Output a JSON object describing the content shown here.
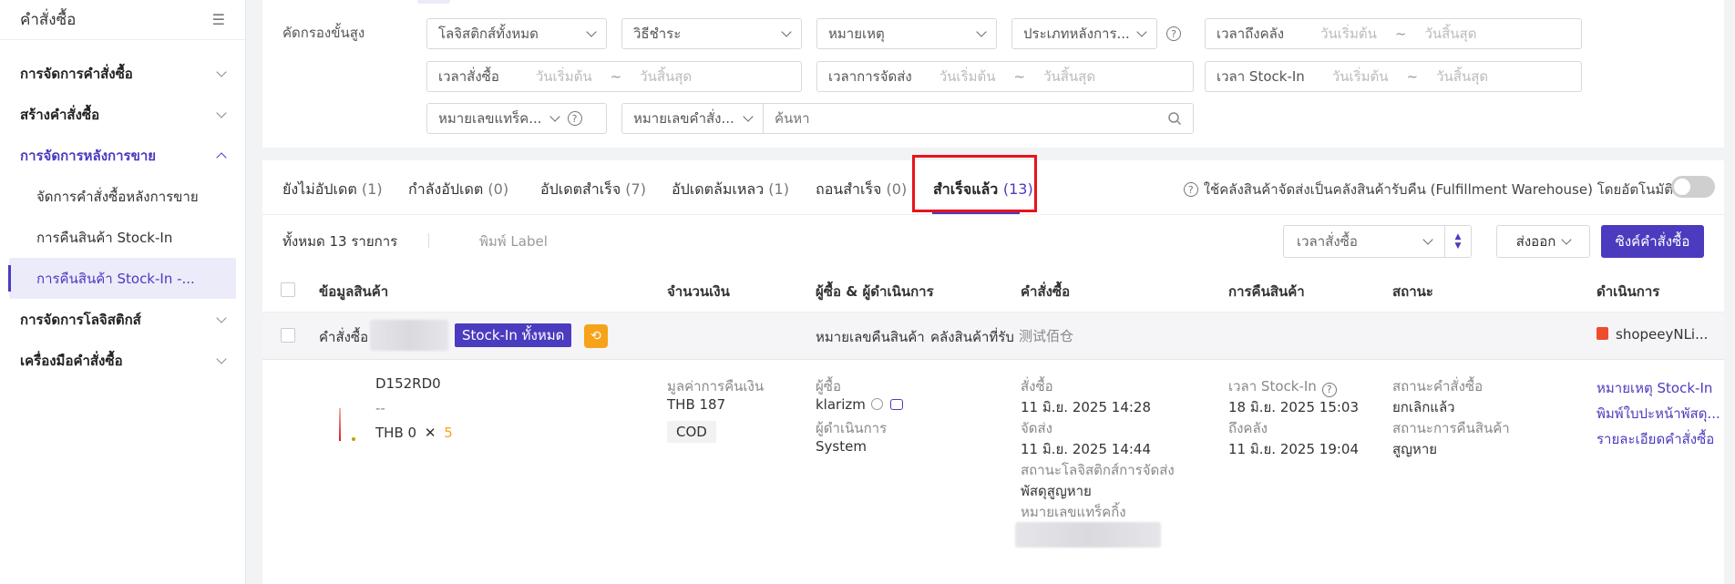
{
  "sidebar": {
    "title": "คำสั่งซื้อ",
    "items": [
      {
        "label": "การจัดการคำสั่งซื้อ"
      },
      {
        "label": "สร้างคำสั่งซื้อ"
      },
      {
        "label": "การจัดการหลังการขาย"
      },
      {
        "label": "การจัดการโลจิสติกส์"
      },
      {
        "label": "เครื่องมือคำสั่งซื้อ"
      }
    ],
    "sub_items": [
      {
        "label": "จัดการคำสั่งซื้อหลังการขาย"
      },
      {
        "label": "การคืนสินค้า Stock-In"
      },
      {
        "label": "การคืนสินค้า Stock-In -..."
      }
    ]
  },
  "filters": {
    "label": "คัดกรองขั้นสูง",
    "logistics": "โลจิสติกส์ทั้งหมด",
    "payment": "วิธีชำระ",
    "note": "หมายเหตุ",
    "after_type": "ประเภทหลังการ...",
    "warehouse_time": "เวลาถึงคลัง",
    "order_time": "เวลาสั่งซื้อ",
    "ship_time": "เวลาการจัดส่ง",
    "stockin_time": "เวลา Stock-In",
    "start_ph": "วันเริ่มต้น",
    "end_ph": "วันสิ้นสุด",
    "tilde": "~",
    "tracking": "หมายเลขแทร็ค...",
    "order_no": "หมายเลขคำสั่ง...",
    "search_ph": "ค้นหา"
  },
  "tabs": [
    {
      "label": "ยังไม่อัปเดต",
      "count": "(1)"
    },
    {
      "label": "กำลังอัปเดต",
      "count": "(0)"
    },
    {
      "label": "อัปเดตสำเร็จ",
      "count": "(7)"
    },
    {
      "label": "อัปเดตล้มเหลว",
      "count": "(1)"
    },
    {
      "label": "ถอนสำเร็จ",
      "count": "(0)"
    },
    {
      "label": "สำเร็จแล้ว",
      "count": "(13)"
    }
  ],
  "auto_setting": "ใช้คลังสินค้าจัดส่งเป็นคลังสินค้ารับคืน (Fulfillment Warehouse) โดยอัตโนมัติ",
  "toolbar": {
    "total": "ทั้งหมด 13 รายการ",
    "print": "พิมพ์ Label",
    "sort": "เวลาสั่งซื้อ",
    "export": "ส่งออก",
    "sync": "ซิงค์คำสั่งซื้อ"
  },
  "table": {
    "headers": [
      "ข้อมูลสินค้า",
      "จำนวนเงิน",
      "ผู้ซื้อ & ผู้ดำเนินการ",
      "คำสั่งซื้อ",
      "การคืนสินค้า",
      "สถานะ",
      "ดำเนินการ"
    ],
    "group": {
      "order_label": "คำสั่งซื้อ",
      "badge": "Stock-In ทั้งหมด",
      "return_label": "หมายเลขคืนสินค้า",
      "warehouse_label": "คลังสินค้าที่รับ",
      "warehouse_name": "测试佰仓",
      "shop": "shopeeyNLi..."
    },
    "row": {
      "sku": "D152RD0",
      "dash": "--",
      "price": "THB 0",
      "times": "✕",
      "qty": "5",
      "refund_label": "มูลค่าการคืนเงิน",
      "refund_value": "THB 187",
      "payment": "COD",
      "buyer_label": "ผู้ซื้อ",
      "buyer": "klarizm",
      "operator_label": "ผู้ดำเนินการ",
      "operator": "System",
      "ordered_label": "สั่งซื้อ",
      "ordered": "11 มิ.ย. 2025 14:28",
      "shipped_label": "จัดส่ง",
      "shipped": "11 มิ.ย. 2025 14:44",
      "logistics_status_label": "สถานะโลจิสติกส์การจัดส่ง",
      "logistics_status": "พัสดุสูญหาย",
      "tracking_label": "หมายเลขแทร็คกิ้ง",
      "stockin_label": "เวลา Stock-In",
      "stockin": "18 มิ.ย. 2025 15:03",
      "arrive_label": "ถึงคลัง",
      "arrive": "11 มิ.ย. 2025 19:04",
      "order_status_label": "สถานะคำสั่งซื้อ",
      "order_status": "ยกเลิกแล้ว",
      "return_status_label": "สถานะการคืนสินค้า",
      "return_status": "สูญหาย",
      "actions": [
        "หมายเหตุ Stock-In",
        "พิมพ์ใบปะหน้าพัสดุ...",
        "รายละเอียดคำสั่งซื้อ"
      ]
    }
  },
  "colors": {
    "accent": "#4b3bbf",
    "highlight": "#e8141b",
    "badge_orange": "#f7a21b"
  }
}
